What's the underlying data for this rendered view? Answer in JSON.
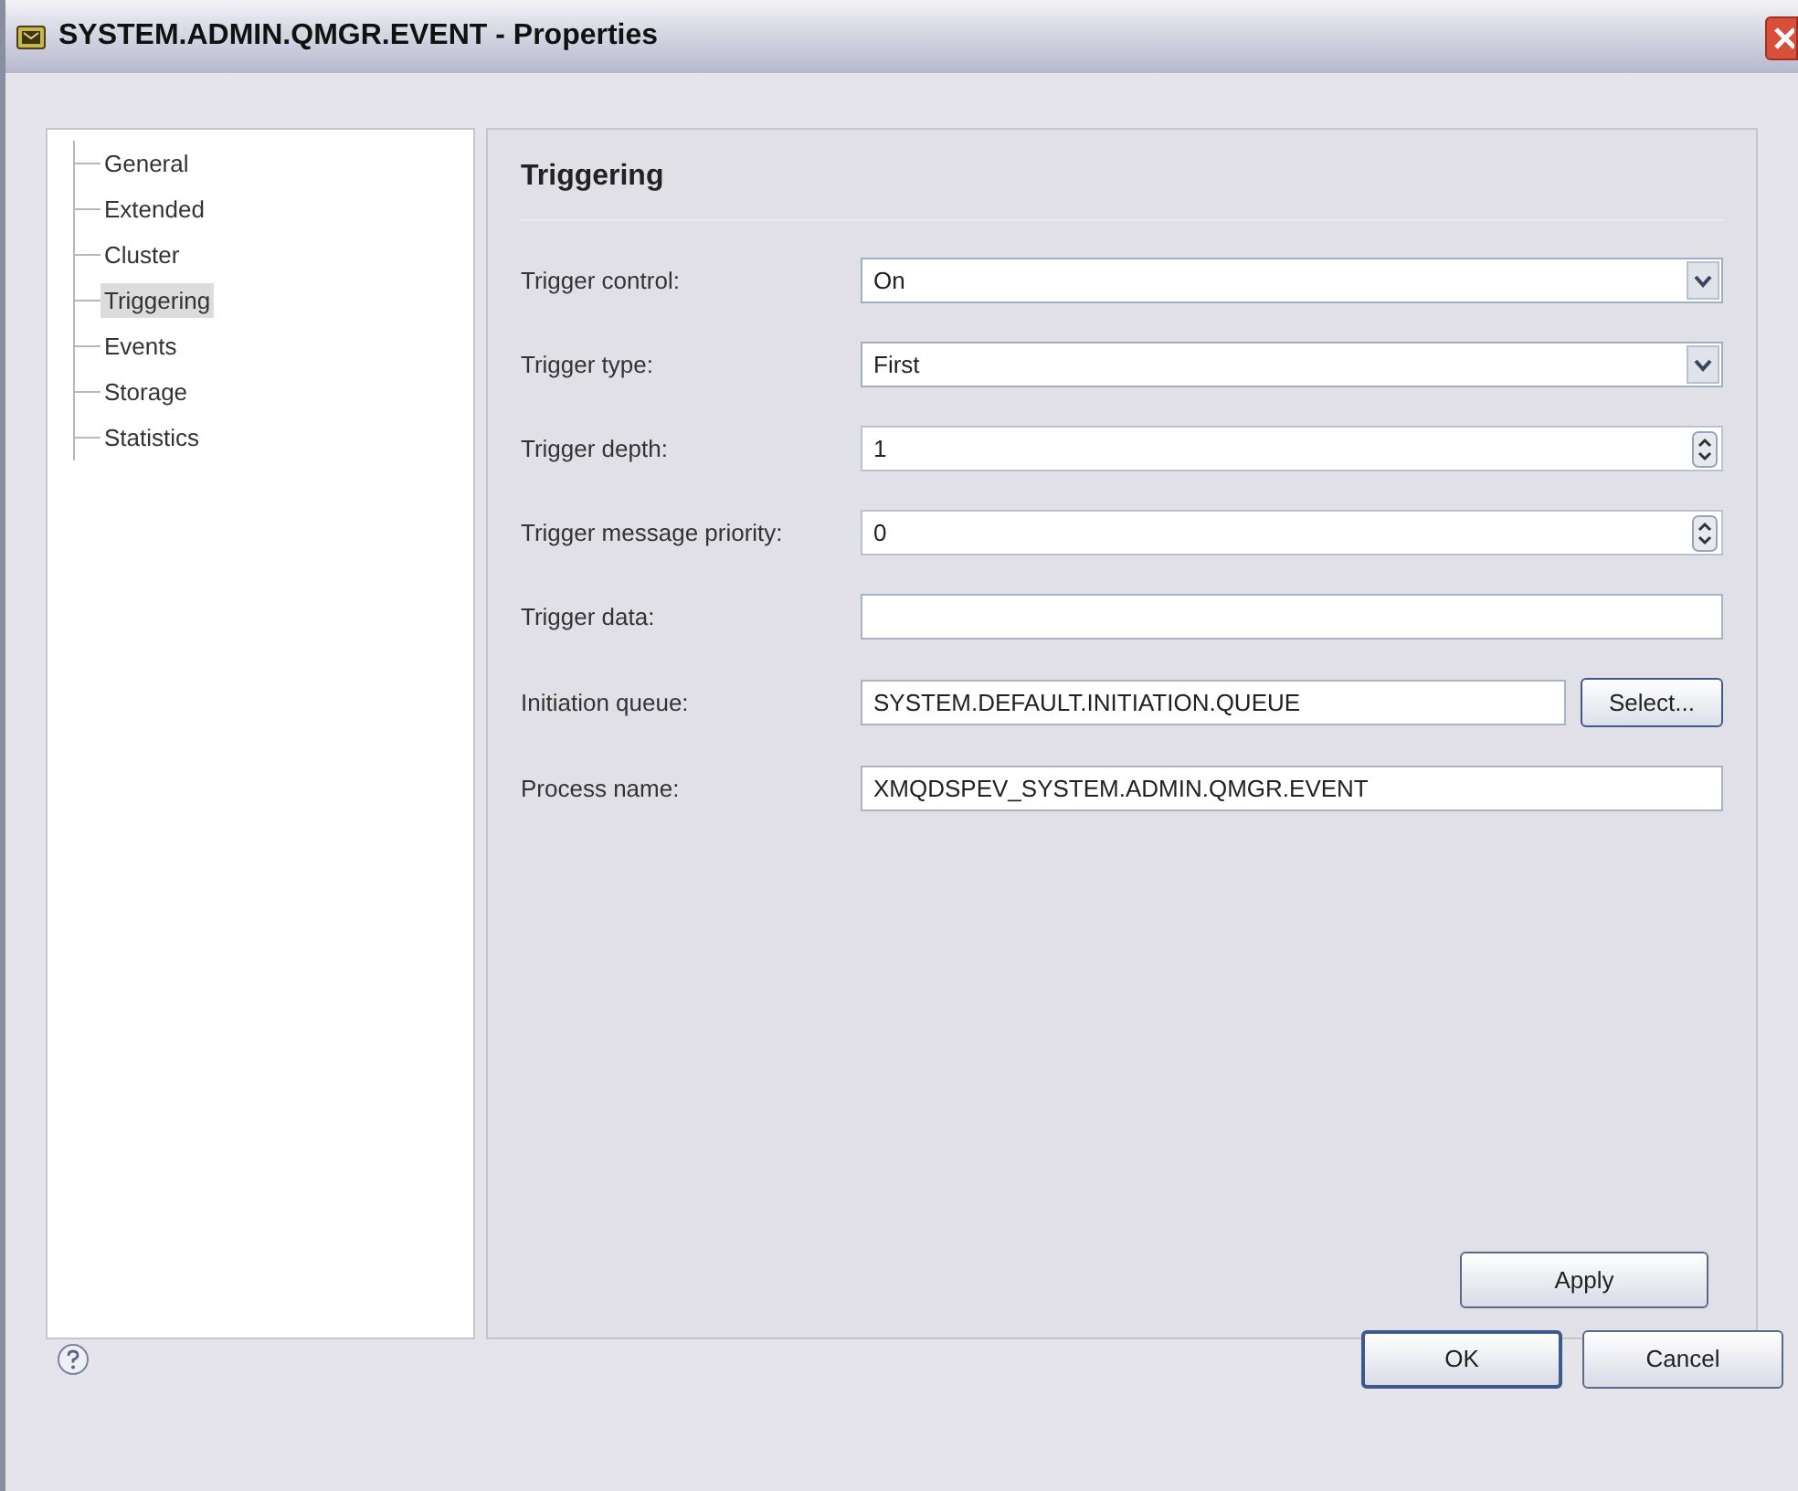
{
  "window": {
    "title": "SYSTEM.ADMIN.QMGR.EVENT - Properties"
  },
  "sidebar": {
    "items": [
      {
        "label": "General",
        "selected": false
      },
      {
        "label": "Extended",
        "selected": false
      },
      {
        "label": "Cluster",
        "selected": false
      },
      {
        "label": "Triggering",
        "selected": true
      },
      {
        "label": "Events",
        "selected": false
      },
      {
        "label": "Storage",
        "selected": false
      },
      {
        "label": "Statistics",
        "selected": false
      }
    ]
  },
  "page": {
    "title": "Triggering",
    "fields": [
      {
        "kind": "combo",
        "label": "Trigger control:",
        "value": "On"
      },
      {
        "kind": "combo",
        "label": "Trigger type:",
        "value": "First"
      },
      {
        "kind": "spinner",
        "label": "Trigger depth:",
        "value": "1"
      },
      {
        "kind": "spinner",
        "label": "Trigger message priority:",
        "value": "0"
      },
      {
        "kind": "text",
        "label": "Trigger data:"
      },
      {
        "kind": "text_button",
        "label": "Initiation queue:",
        "value": "SYSTEM.DEFAULT.INITIATION.QUEUE",
        "button": "Select..."
      },
      {
        "kind": "text",
        "label": "Process name:",
        "value": "XMQDSPEV_SYSTEM.ADMIN.QMGR.EVENT"
      }
    ],
    "apply_button": "Apply"
  },
  "buttons": [
    "OK",
    "Cancel"
  ]
}
